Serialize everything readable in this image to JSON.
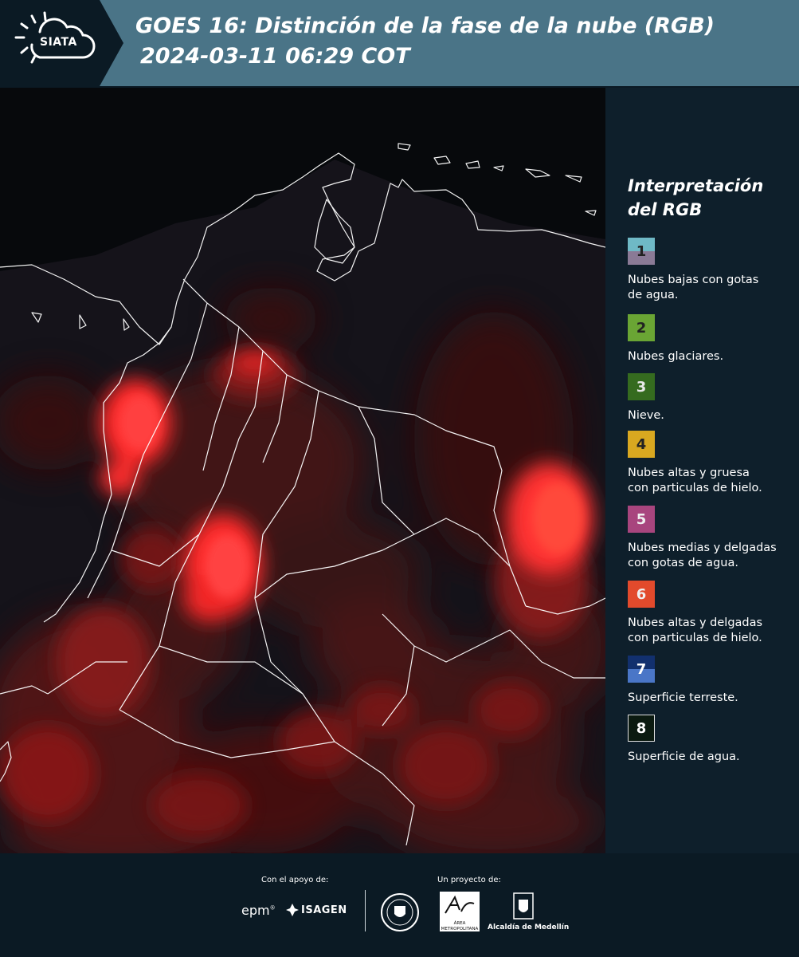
{
  "header": {
    "logo_text": "SIATA",
    "title_line1": "GOES 16: Distinción de la fase de la nube (RGB)",
    "title_line2": "2024-03-11 06:29 COT"
  },
  "legend": {
    "title_line1": "Interpretación",
    "title_line2": "del RGB",
    "items": [
      {
        "number": "1",
        "label_line1": "Nubes bajas con gotas",
        "label_line2": "de agua.",
        "color_top": "#6fb9c6",
        "color_bottom": "#8a7a96"
      },
      {
        "number": "2",
        "label_line1": "Nubes glaciares.",
        "label_line2": "",
        "color_top": "#6aa534",
        "color_bottom": "#6aa534"
      },
      {
        "number": "3",
        "label_line1": "Nieve.",
        "label_line2": "",
        "color_top": "#356b1f",
        "color_bottom": "#356b1f"
      },
      {
        "number": "4",
        "label_line1": "Nubes altas y gruesa",
        "label_line2": "con particulas de hielo.",
        "color_top": "#d9a820",
        "color_bottom": "#d9a820"
      },
      {
        "number": "5",
        "label_line1": "Nubes medias y delgadas",
        "label_line2": "con gotas de agua.",
        "color_top": "#a8457e",
        "color_bottom": "#a8457e"
      },
      {
        "number": "6",
        "label_line1": "Nubes altas y delgadas",
        "label_line2": "con particulas de hielo.",
        "color_top": "#e24a2c",
        "color_bottom": "#e24a2c"
      },
      {
        "number": "7",
        "label_line1": "Superficie terreste.",
        "label_line2": "",
        "color_top": "#12306e",
        "color_bottom": "#4a76c7"
      },
      {
        "number": "8",
        "label_line1": "Superficie de agua.",
        "label_line2": "",
        "color_top": "#0b1a10",
        "color_bottom": "#0b1a10"
      }
    ]
  },
  "footer": {
    "support_label": "Con el apoyo de:",
    "project_label": "Un proyecto de:",
    "sponsor1": "epm",
    "sponsor2": "ISAGEN",
    "partner1": "ÁREA METROPOLITANA",
    "partner2": "Alcaldía de Medellín"
  }
}
